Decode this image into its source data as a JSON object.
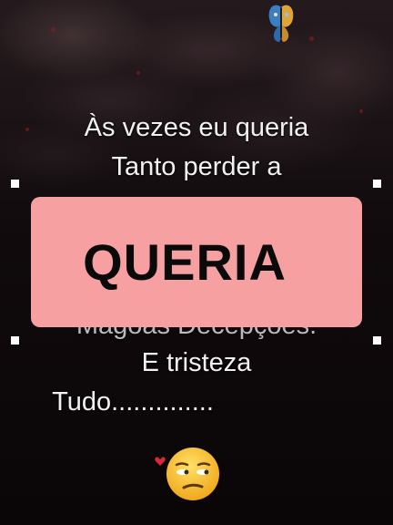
{
  "caption": {
    "lines": [
      "Às vezes eu queria",
      "Tanto perder a"
    ],
    "hidden_line": "Mágoas Decepções.",
    "after_lines": [
      "E tristeza",
      "Tudo.............."
    ]
  },
  "overlay": {
    "label": "QUERIA",
    "background": "#f7a0a2",
    "text_color": "#0a0a0a"
  },
  "icons": {
    "top_decoration": "butterfly-icon",
    "bottom_decoration": "unamused-face-emoji",
    "heart": "heart-icon"
  },
  "colors": {
    "caption_text": "#f1f1f1",
    "handle": "#ffffff",
    "background": "#0b0709"
  }
}
